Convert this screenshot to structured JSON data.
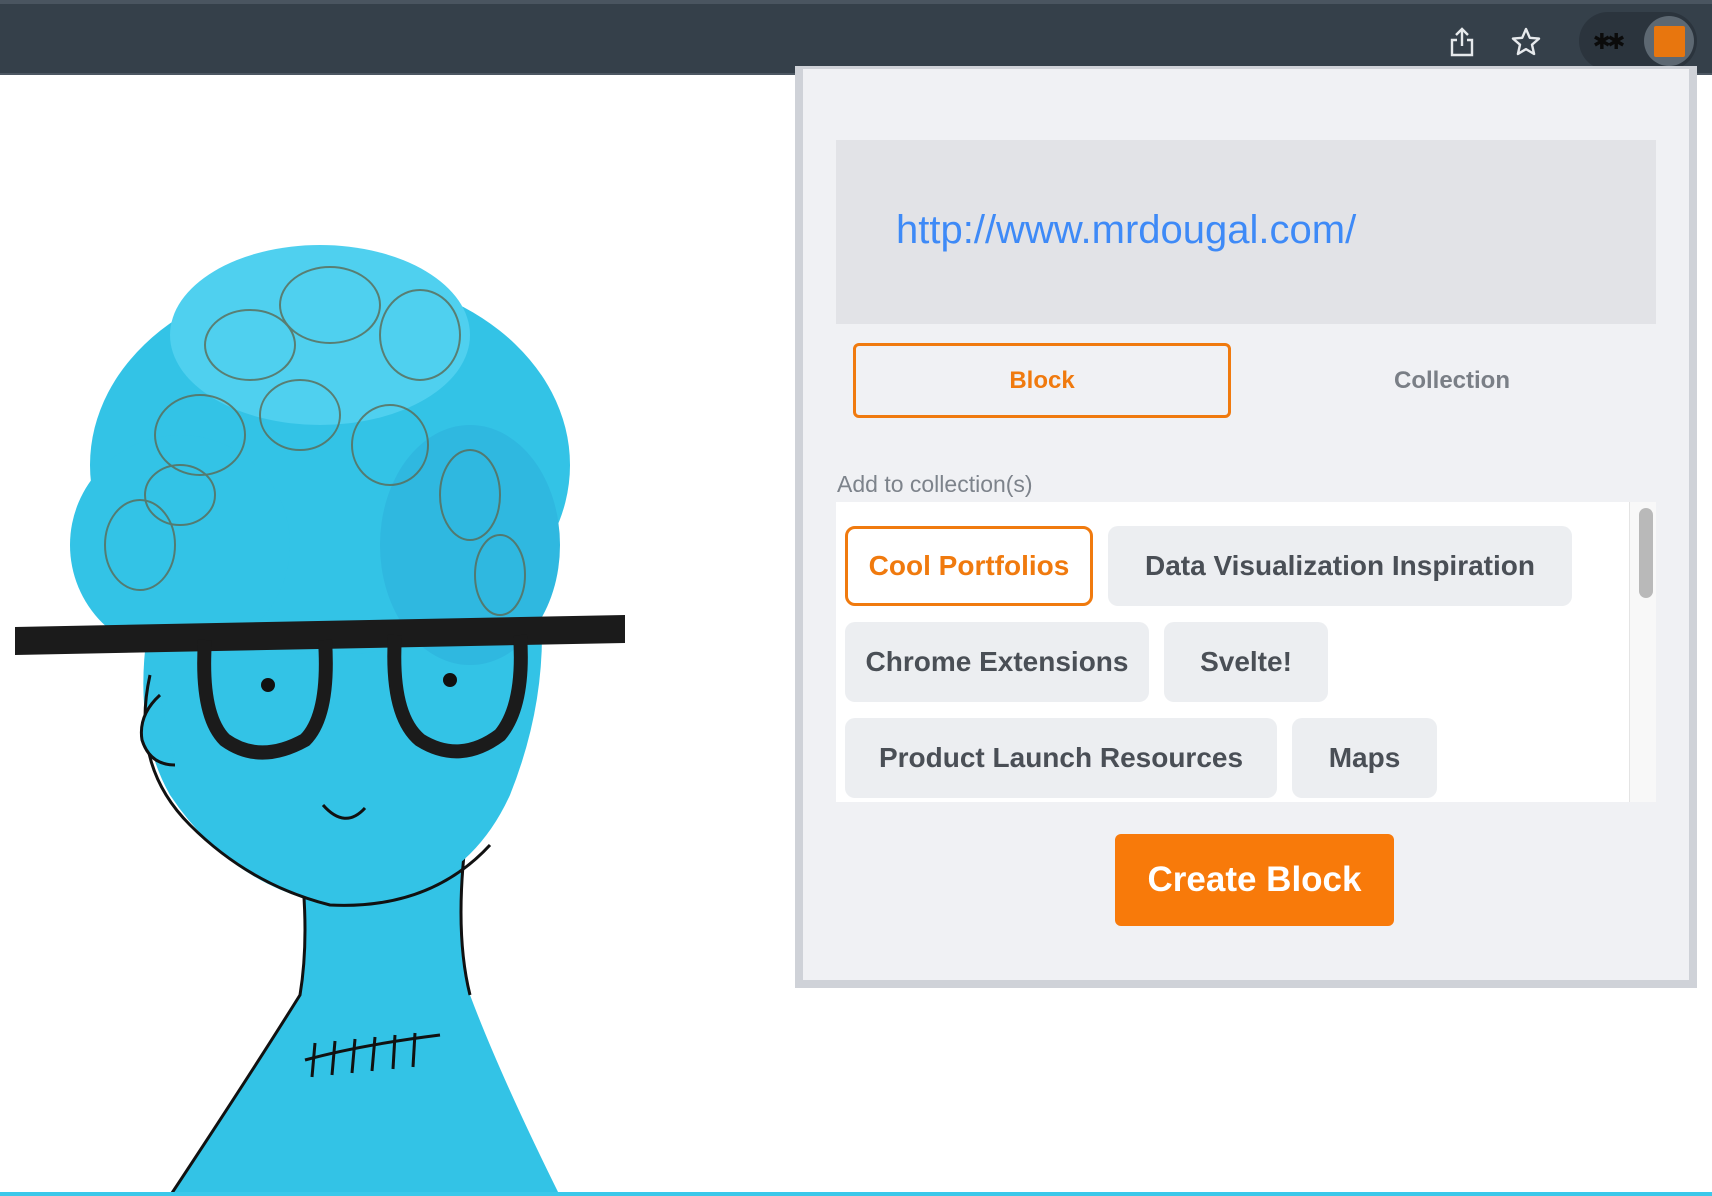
{
  "browser": {
    "share_icon": "share-icon",
    "bookmark_icon": "star-icon",
    "extensions_icon": "puzzle-icon",
    "active_extension_icon": "orange-square-icon",
    "accent_color": "#e8760e"
  },
  "popup": {
    "url": "http://www.mrdougal.com/",
    "tabs": [
      {
        "label": "Block",
        "active": true
      },
      {
        "label": "Collection",
        "active": false
      }
    ],
    "add_label": "Add to collection(s)",
    "collections": [
      {
        "label": "Cool Portfolios",
        "selected": true
      },
      {
        "label": "Data Visualization Inspiration",
        "selected": false
      },
      {
        "label": "Chrome Extensions",
        "selected": false
      },
      {
        "label": "Svelte!",
        "selected": false
      },
      {
        "label": "Product Launch Resources",
        "selected": false
      },
      {
        "label": "Maps",
        "selected": false
      }
    ],
    "create_label": "Create Block",
    "colors": {
      "accent": "#f87a0a",
      "link": "#3e8af7"
    }
  }
}
